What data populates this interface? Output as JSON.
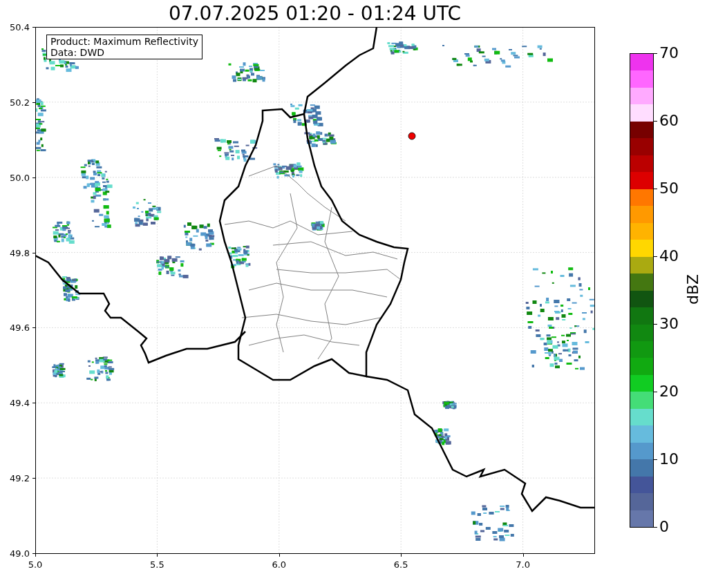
{
  "title": "07.07.2025 01:20 - 01:24 UTC",
  "info_box": [
    "Product: Maximum Reflectivity",
    "Data: DWD"
  ],
  "map": {
    "xticks": [
      "5.0",
      "5.5",
      "6.0",
      "6.5",
      "7.0"
    ],
    "yticks": [
      "50.4",
      "50.2",
      "50.0",
      "49.8",
      "49.6",
      "49.4",
      "49.2",
      "49.0"
    ]
  },
  "colorbar": {
    "label": "dBZ",
    "ticks": [
      "70",
      "60",
      "50",
      "40",
      "30",
      "20",
      "10",
      "0"
    ],
    "segments": [
      {
        "color": "#ee33ee"
      },
      {
        "color": "#ff66ff"
      },
      {
        "color": "#ffaaff"
      },
      {
        "color": "#ffddff"
      },
      {
        "color": "#770000"
      },
      {
        "color": "#990000"
      },
      {
        "color": "#bb0000"
      },
      {
        "color": "#dd0000"
      },
      {
        "color": "#ff7700"
      },
      {
        "color": "#ff9900"
      },
      {
        "color": "#ffb300"
      },
      {
        "color": "#ffd700"
      },
      {
        "color": "#aaaa11"
      },
      {
        "color": "#447711"
      },
      {
        "color": "#115511"
      },
      {
        "color": "#117711"
      },
      {
        "color": "#118811"
      },
      {
        "color": "#119911"
      },
      {
        "color": "#11aa11"
      },
      {
        "color": "#11cc22"
      },
      {
        "color": "#44dd77"
      },
      {
        "color": "#66ddcc"
      },
      {
        "color": "#66bbdd"
      },
      {
        "color": "#5599cc"
      },
      {
        "color": "#4477aa"
      },
      {
        "color": "#445599"
      },
      {
        "color": "#556699"
      },
      {
        "color": "#6677aa"
      }
    ]
  }
}
